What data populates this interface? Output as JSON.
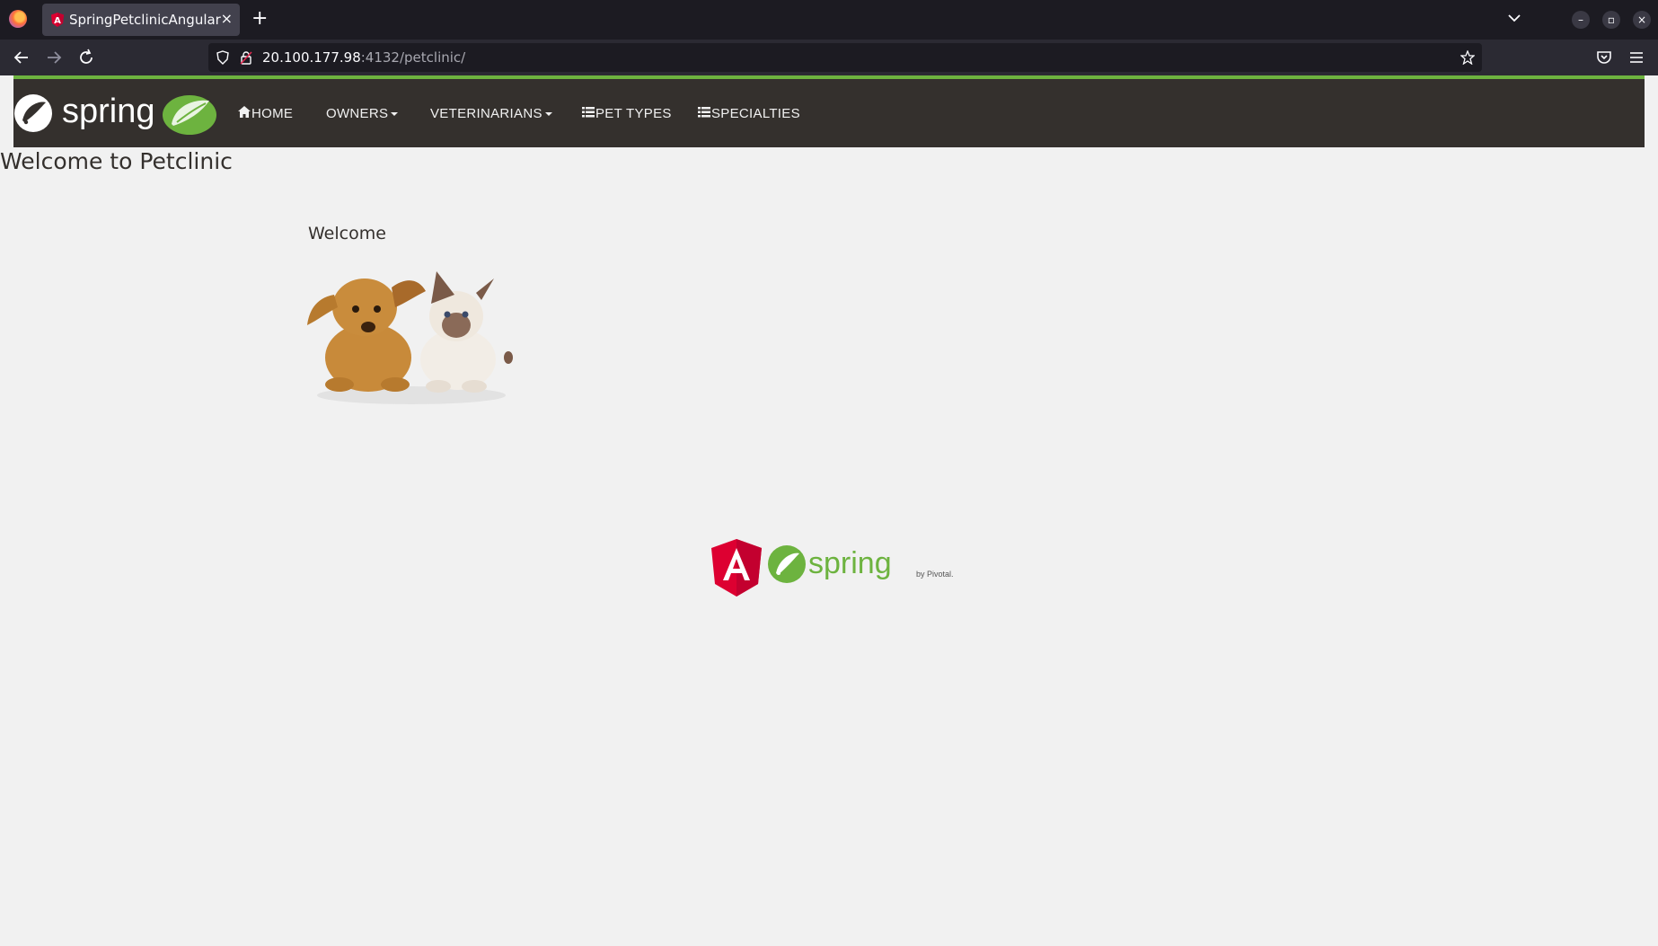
{
  "browser": {
    "tab_title": "SpringPetclinicAngular",
    "tab_close": "×",
    "new_tab": "+",
    "url_host": "20.100.177.98",
    "url_rest": ":4132/petclinic/"
  },
  "nav": {
    "brand_text": "spring",
    "items": [
      {
        "label": "HOME",
        "icon": "home-icon",
        "dropdown": false
      },
      {
        "label": "OWNERS",
        "icon": null,
        "dropdown": true
      },
      {
        "label": "VETERINARIANS",
        "icon": null,
        "dropdown": true
      },
      {
        "label": "PET TYPES",
        "icon": "list-icon",
        "dropdown": false
      },
      {
        "label": "SPECIALTIES",
        "icon": "list-icon",
        "dropdown": false
      }
    ],
    "accent": "#6db33f",
    "background": "#34302d"
  },
  "page": {
    "title": "Welcome to Petclinic",
    "subtitle": "Welcome"
  },
  "footer": {
    "spring_text": "spring",
    "pivotal_text": "by Pivotal.",
    "angular_color": "#dd0031",
    "spring_color": "#6db33f"
  }
}
